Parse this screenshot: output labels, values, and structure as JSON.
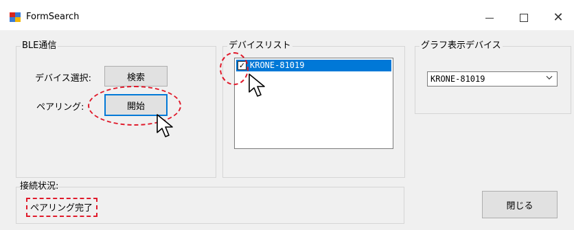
{
  "window": {
    "title": "FormSearch",
    "controls": {
      "minimize": "minimize",
      "maximize": "maximize",
      "close": "✕"
    }
  },
  "ble_group": {
    "title": "BLE通信",
    "device_select_label": "デバイス選択:",
    "search_button": "検索",
    "pairing_label": "ペアリング:",
    "start_button": "開始"
  },
  "device_list_group": {
    "title": "デバイスリスト",
    "items": [
      {
        "label": "KRONE-81019",
        "checked": true,
        "selected": true
      }
    ]
  },
  "graph_group": {
    "title": "グラフ表示デバイス",
    "selected_device": "KRONE-81019"
  },
  "status_group": {
    "title": "接続状況:",
    "value": "ペアリング完了"
  },
  "close_button": "閉じる",
  "colors": {
    "selection": "#0078d7",
    "annotation": "#e0192a",
    "window_bg": "#f0f0f0"
  }
}
